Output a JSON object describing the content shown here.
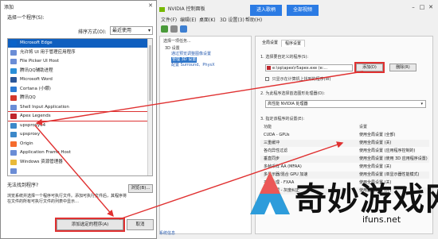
{
  "colors": {
    "accent": "#0f5fbf",
    "nvidia_green": "#76b900",
    "highlight_red": "#e03131",
    "selection": "#2e76c9"
  },
  "add_dialog": {
    "title": "添加",
    "select_label": "选择一个程序(S):",
    "sort_label": "排序方式(O):",
    "sort_value": "最近使用",
    "programs": [
      {
        "label": "Microsoft Edge",
        "icon": "edge-icon",
        "color": "#0a63c9",
        "selected": true
      },
      {
        "label": "允许将 UI 用于管理应用程序",
        "icon": "app-icon",
        "color": "#6b8dd6"
      },
      {
        "label": "File Picker UI Host",
        "icon": "app-icon",
        "color": "#6b8dd6"
      },
      {
        "label": "腾讯QQ辅助进程",
        "icon": "qq-icon",
        "color": "#2a8fd8"
      },
      {
        "label": "Microsoft Word",
        "icon": "word-icon",
        "color": "#2b579a"
      },
      {
        "label": "Cortana (小娜)",
        "icon": "cortana-icon",
        "color": "#2d7bd4"
      },
      {
        "label": "腾讯QQ",
        "icon": "qq-penguin-icon",
        "color": "#d4382c"
      },
      {
        "label": "Shell Input Application",
        "icon": "app-icon",
        "color": "#6b8dd6"
      },
      {
        "label": "Apex Legends",
        "icon": "apex-icon",
        "color": "#c0262d",
        "highlight": true
      },
      {
        "label": "upsproxy64",
        "icon": "app-icon",
        "color": "#3c88c9"
      },
      {
        "label": "upsproxy",
        "icon": "app-icon",
        "color": "#3c88c9"
      },
      {
        "label": "Origin",
        "icon": "origin-icon",
        "color": "#f56c2d"
      },
      {
        "label": "Application Frame Host",
        "icon": "app-icon",
        "color": "#6b8dd6"
      },
      {
        "label": "Windows 资源管理器",
        "icon": "folder-icon",
        "color": "#e8b93a"
      },
      {
        "label": "",
        "icon": "app-icon",
        "color": "#6b8dd6"
      }
    ],
    "not_found_label": "无法找到程序?",
    "description": "浏览系统并选择一个程序可执行文件。添加可执行文件后，其程序将在文件的所有可执行文件的列表中显示…",
    "browse_label": "浏览(B)...",
    "add_button_label": "添加选定的程序(A)",
    "cancel_button_label": "取消"
  },
  "nvidia_panel": {
    "top_buttons": [
      "进入歌柄",
      "全部视频"
    ],
    "window_title": "NVIDIA 控制面板",
    "menu": [
      "文件(F)",
      "编辑(E)",
      "桌面(K)",
      "3D 设置(3)",
      "帮助(H)"
    ],
    "tree": {
      "header": "选择一项任务...",
      "items": [
        "3D 设置",
        "通过预览调整图像设置",
        "管理 3D 设置",
        "配置 Surround、PhysX"
      ],
      "selected_index": 2
    },
    "tabs": [
      "全局设置",
      "程序设置"
    ],
    "step1_label": "1. 选择要自定义的程序(S):",
    "program_value": "e:\\op\\apex\\r5apex.exe (e:...",
    "add_label": "添加(D)",
    "remove_label": "删除(R)",
    "show_only_label": "只显示在计算机上找到的程序(W)",
    "step2_label": "2. 为此程序选择首选图形处理器(O):",
    "gpu_value": "高性能 NVIDIA 处理器",
    "step3_label": "3. 指定该程序的设置(E):",
    "table_headers": [
      "功能",
      "设置"
    ],
    "settings": [
      [
        "CUDA - GPUs",
        "使用全局设置 (全部)"
      ],
      [
        "三重缓冲",
        "使用全局设置 (关)"
      ],
      [
        "各向异性过滤",
        "使用全局设置 (应用程序控制的)"
      ],
      [
        "垂直同步",
        "使用全局设置 (使用 3D 应用程序设置)"
      ],
      [
        "多帧采样 AA (MFAA)",
        "使用全局设置 (关)"
      ],
      [
        "多显示器/混合 GPU 加速",
        "使用全局设置 (单显示器性能模式)"
      ],
      [
        "平滑处理 - FXAA",
        "使用全局设置 (关)"
      ],
      [
        "平滑处理 - 灰度纠正",
        "使用全局设置 (开)"
      ]
    ],
    "status_link": "系统信息"
  },
  "watermark": {
    "text": "奇妙游戏网",
    "url": "ifuns.net"
  }
}
